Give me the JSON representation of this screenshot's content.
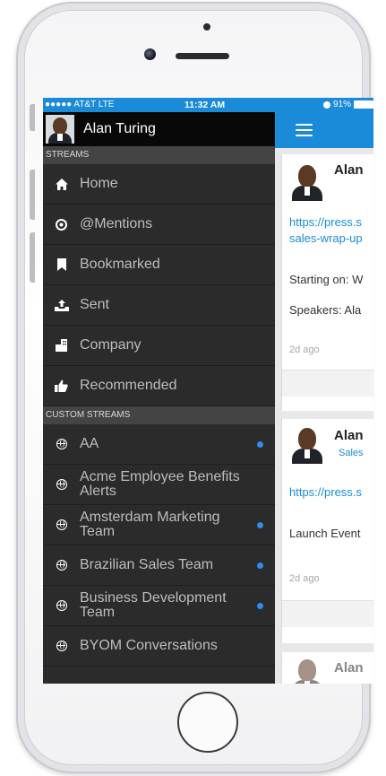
{
  "status_bar": {
    "carrier": "●●●●● AT&T  LTE",
    "time": "11:32 AM",
    "battery": "91%"
  },
  "sidebar": {
    "profile_name": "Alan Turing",
    "streams_header": "STREAMS",
    "streams": [
      {
        "label": "Home",
        "icon": "home-icon"
      },
      {
        "label": "@Mentions",
        "icon": "at-icon"
      },
      {
        "label": "Bookmarked",
        "icon": "bookmark-icon"
      },
      {
        "label": "Sent",
        "icon": "sent-icon"
      },
      {
        "label": "Company",
        "icon": "company-icon"
      },
      {
        "label": "Recommended",
        "icon": "thumbs-up-icon"
      }
    ],
    "custom_header": "CUSTOM STREAMS",
    "custom_streams": [
      {
        "label": "AA",
        "unread": true
      },
      {
        "label": "Acme Employee Benefits Alerts",
        "unread": false
      },
      {
        "label": "Amsterdam Marketing Team",
        "unread": true
      },
      {
        "label": "Brazilian Sales Team",
        "unread": true
      },
      {
        "label": "Business Development Team",
        "unread": true
      },
      {
        "label": "BYOM Conversations",
        "unread": false
      }
    ]
  },
  "feed": {
    "posts": [
      {
        "author": "Alan",
        "link_line1": "https://press.s",
        "link_line2": "sales-wrap-up",
        "text_line1": "Starting on: W",
        "text_line2": "Speakers: Ala",
        "time": "2d ago"
      },
      {
        "author": "Alan",
        "group": "Sales",
        "link_line1": "https://press.s",
        "text_line1": "Launch Event",
        "time": "2d ago"
      },
      {
        "author": "Alan"
      }
    ]
  },
  "colors": {
    "accent": "#1a8bd8",
    "sidebar_bg": "#2b2b2b",
    "unread_dot": "#2d8df0"
  }
}
